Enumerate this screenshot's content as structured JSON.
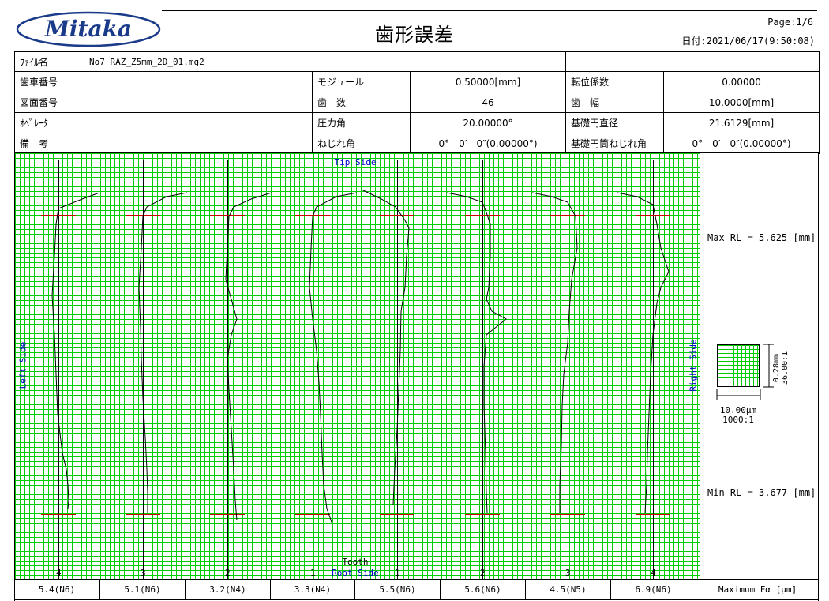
{
  "header": {
    "logo_text": "Mitaka",
    "title": "歯形誤差",
    "page": "Page:1/6",
    "date": "日付:2021/06/17(9:50:08)"
  },
  "info": {
    "file_label": "ﾌｧｲﾙ名",
    "file_value": "No7 RAZ_Z5mm_2D_01.mg2",
    "gear_no_label": "歯車番号",
    "gear_no_value": "",
    "drawing_no_label": "図面番号",
    "drawing_no_value": "",
    "operator_label": "ｵﾍﾟﾚｰﾀ",
    "operator_value": "",
    "remarks_label": "備　考",
    "remarks_value": "",
    "module_label": "モジュール",
    "module_value": "0.50000[mm]",
    "teeth_label": "歯　数",
    "teeth_value": "46",
    "pressure_angle_label": "圧力角",
    "pressure_angle_value": "20.00000°",
    "helix_angle_label": "ねじれ角",
    "helix_angle_value": "0°　0′　0″(0.00000°)",
    "shift_label": "転位係数",
    "shift_value": "0.00000",
    "face_width_label": "歯　幅",
    "face_width_value": "10.0000[mm]",
    "base_dia_label": "基礎円直径",
    "base_dia_value": "21.6129[mm]",
    "base_helix_label": "基礎円筒ねじれ角",
    "base_helix_value": "0°　0′　0″(0.00000°)"
  },
  "chart": {
    "tip_side": "Tip Side",
    "root_side": "Root Side",
    "tooth_label": "Tooth",
    "left_side": "Left Side",
    "right_side": "Right Side",
    "max_rl": "Max RL = 5.625 [mm]",
    "min_rl": "Min RL = 3.677 [mm]",
    "scale_v": "0.28mm",
    "scale_v_ratio": "36.00:1",
    "scale_h": "10.00μm",
    "scale_h_ratio": "1000:1",
    "colors": {
      "grid": "#00cc00",
      "grid_bg": "#d9ffd9",
      "limit": "#cc0000",
      "label": "#0000cc"
    }
  },
  "teeth": [
    {
      "tooth": "4",
      "value": "5.4(N6)"
    },
    {
      "tooth": "3",
      "value": "5.1(N6)"
    },
    {
      "tooth": "2",
      "value": "3.2(N4)"
    },
    {
      "tooth": "1",
      "value": "3.3(N4)"
    },
    {
      "tooth": "1",
      "value": "5.5(N6)"
    },
    {
      "tooth": "2",
      "value": "5.6(N6)"
    },
    {
      "tooth": "3",
      "value": "4.5(N5)"
    },
    {
      "tooth": "4",
      "value": "6.9(N6)"
    }
  ],
  "bottom_label": "Maximum Fα [μm]"
}
